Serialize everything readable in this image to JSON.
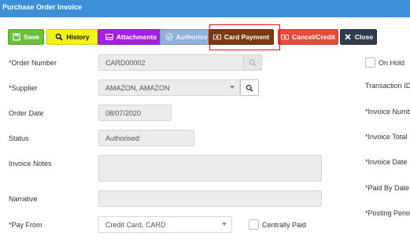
{
  "window": {
    "title": "Purchase Order Invoice"
  },
  "toolbar": {
    "save": "Save",
    "history": "History",
    "attachments": "Attachments",
    "authorise": "Authorise",
    "card_payment": "Card Payment",
    "cancel_credit": "Cancel/Credit",
    "close": "Close"
  },
  "form": {
    "order_number": {
      "label": "*Order Number",
      "value": "CARD00002"
    },
    "supplier": {
      "label": "*Supplier",
      "value": "AMAZON, AMAZON"
    },
    "order_date": {
      "label": "Order Date",
      "value": "08/07/2020"
    },
    "status": {
      "label": "Status",
      "value": "Authorised"
    },
    "invoice_notes": {
      "label": "Invoice Notes",
      "value": ""
    },
    "narrative": {
      "label": "Narrative",
      "value": ""
    },
    "pay_from": {
      "label": "*Pay From",
      "value": "Credit Card, CARD"
    },
    "centrally_paid": {
      "label": "Centrally Paid",
      "checked": false
    }
  },
  "right_panel": {
    "on_hold": {
      "label": "On Hold",
      "checked": false
    },
    "transaction_id": "Transaction ID",
    "invoice_number": "*Invoice Number",
    "invoice_total": "*Invoice Total",
    "invoice_date": "*Invoice Date",
    "paid_by_date": "*Paid By Date",
    "posting_period": "*Posting Period"
  },
  "colors": {
    "header": "#3d8fd8",
    "save": "#6cbf3b",
    "history": "#f4f01a",
    "attachments": "#a321e0",
    "authorise": "#8fb2db",
    "card_payment": "#7a3a12",
    "cancel_credit": "#e64b3b",
    "close": "#2f3d4c",
    "highlight": "#e11111"
  },
  "icons": {
    "save": "floppy-disk-icon",
    "history": "search-icon",
    "attachments": "image-icon",
    "authorise": "check-circle-icon",
    "card_payment": "money-icon",
    "cancel_credit": "money-icon",
    "close": "close-icon",
    "order_lookup": "search-icon",
    "supplier_lookup": "search-icon",
    "dropdown": "chevron-down-icon"
  }
}
